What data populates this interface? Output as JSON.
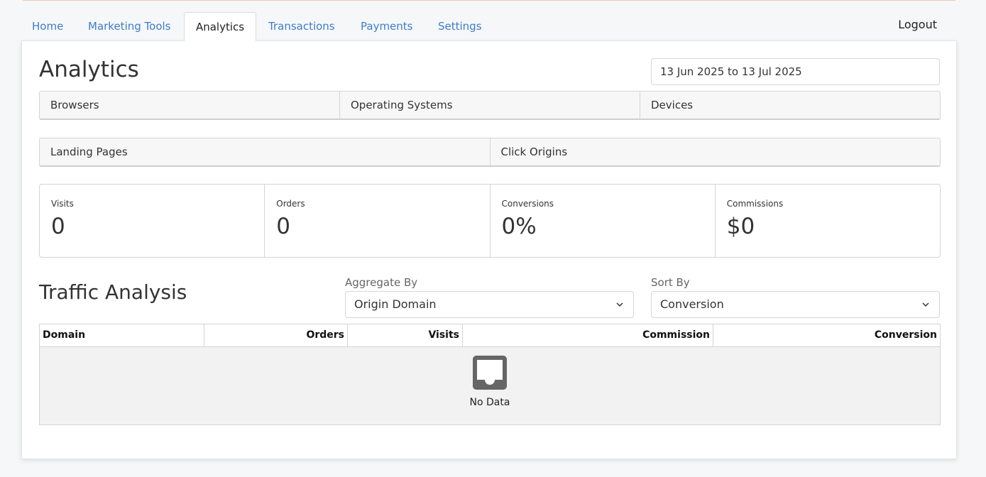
{
  "nav": {
    "tabs": [
      {
        "label": "Home"
      },
      {
        "label": "Marketing Tools"
      },
      {
        "label": "Analytics"
      },
      {
        "label": "Transactions"
      },
      {
        "label": "Payments"
      },
      {
        "label": "Settings"
      }
    ],
    "active_tab": "Analytics",
    "logout_label": "Logout"
  },
  "page": {
    "title": "Analytics",
    "date_range": "13 Jun 2025 to 13 Jul 2025"
  },
  "report_groups": {
    "row1": [
      "Browsers",
      "Operating Systems",
      "Devices"
    ],
    "row2": [
      "Landing Pages",
      "Click Origins"
    ]
  },
  "stats": [
    {
      "label": "Visits",
      "value": "0"
    },
    {
      "label": "Orders",
      "value": "0"
    },
    {
      "label": "Conversions",
      "value": "0%"
    },
    {
      "label": "Commissions",
      "value": "$0"
    }
  ],
  "traffic": {
    "title": "Traffic Analysis",
    "aggregate_label": "Aggregate By",
    "aggregate_value": "Origin Domain",
    "sort_label": "Sort By",
    "sort_value": "Conversion",
    "columns": [
      "Domain",
      "Orders",
      "Visits",
      "Commission",
      "Conversion"
    ],
    "empty_text": "No Data"
  },
  "colors": {
    "link": "#3d7dca",
    "panel_bg": "#ffffff",
    "page_bg": "#f6f7f9",
    "empty_bg": "#f2f2f2",
    "empty_icon": "#666666"
  },
  "icons": {
    "select_chevron": "chevron-down-icon",
    "empty_state": "inbox-icon"
  }
}
